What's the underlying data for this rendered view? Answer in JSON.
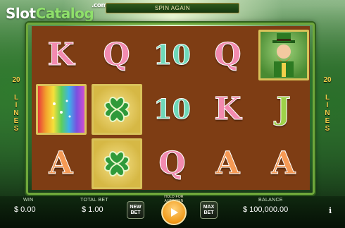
{
  "watermark": {
    "slot": "Slot",
    "catalog": "Catalog",
    "dot_com": ".com"
  },
  "banner": {
    "text": "SPIN AGAIN"
  },
  "side_lines": {
    "count": "20",
    "label": "LINES"
  },
  "reels": {
    "row1": [
      "K",
      "Q",
      "10",
      "Q",
      "leprechaun"
    ],
    "row2": [
      "rainbow",
      "clover",
      "10",
      "K",
      "J"
    ],
    "row3": [
      "A",
      "clover",
      "Q",
      "A",
      "A"
    ]
  },
  "bottom_bar": {
    "win_label": "WIN",
    "win_value": "$ 0.00",
    "total_bet_label": "TOTAL BET",
    "total_bet_value": "$ 1.00",
    "new_bet_label": "NEW BET",
    "hold_label": "HOLD FOR AUTOSPIN",
    "max_bet_label": "MAX BET",
    "balance_label": "BALANCE",
    "balance_value": "$ 100,000.00",
    "info_label": "i"
  },
  "icons": [
    "play-icon",
    "clover-icon",
    "rainbow-icon",
    "leprechaun-icon"
  ]
}
